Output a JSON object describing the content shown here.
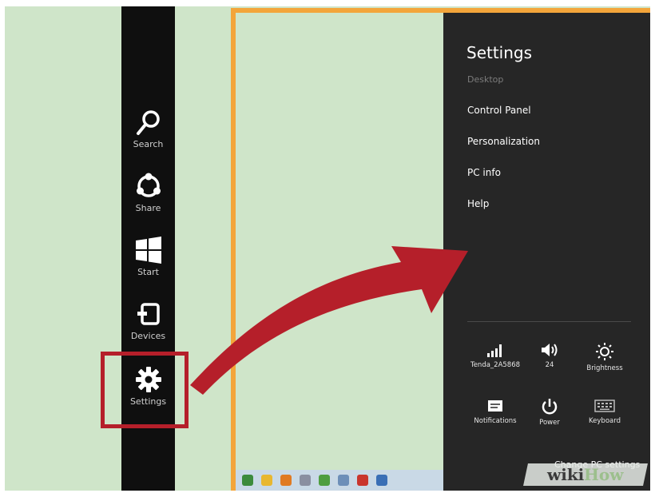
{
  "charms": [
    {
      "label": "Search",
      "icon": "search-icon"
    },
    {
      "label": "Share",
      "icon": "share-icon"
    },
    {
      "label": "Start",
      "icon": "windows-logo-icon"
    },
    {
      "label": "Devices",
      "icon": "devices-icon"
    },
    {
      "label": "Settings",
      "icon": "gear-icon"
    }
  ],
  "settings_panel": {
    "title": "Settings",
    "context": "Desktop",
    "links": [
      "Control Panel",
      "Personalization",
      "PC info",
      "Help"
    ],
    "quick_settings": [
      {
        "label": "Tenda_2A5868",
        "icon": "network-signal-icon"
      },
      {
        "label": "24",
        "icon": "volume-icon"
      },
      {
        "label": "Brightness",
        "icon": "brightness-icon"
      },
      {
        "label": "Notifications",
        "icon": "notifications-icon"
      },
      {
        "label": "Power",
        "icon": "power-icon"
      },
      {
        "label": "Keyboard",
        "icon": "keyboard-icon"
      }
    ],
    "change_pc_settings": "Change PC settings"
  },
  "watermark": {
    "part1": "wiki",
    "part2": "How"
  },
  "colors": {
    "highlight": "#b51f2a",
    "frame_border": "#f3a53a",
    "panel_bg": "#262626",
    "charms_bg": "#0f0f0f",
    "desktop_bg": "#cfe5c9"
  }
}
